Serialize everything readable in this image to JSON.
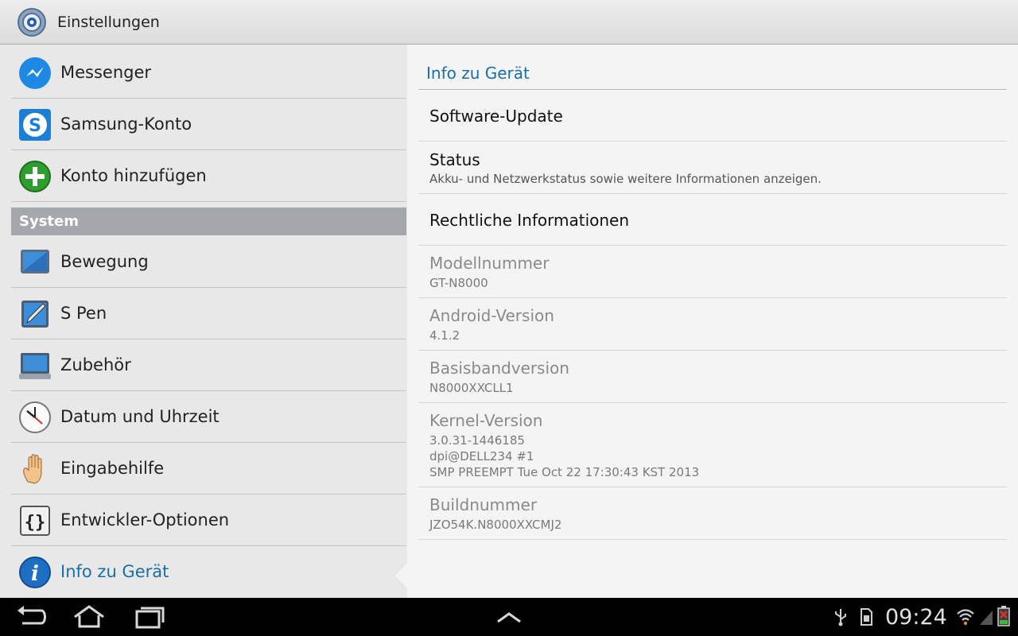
{
  "app": {
    "title": "Einstellungen",
    "icon": "settings-gear-icon"
  },
  "sidebar": {
    "items_top": [
      {
        "label": "Messenger",
        "icon": "messenger-icon"
      },
      {
        "label": "Samsung-Konto",
        "icon": "samsung-account-icon"
      },
      {
        "label": "Konto hinzufügen",
        "icon": "add-account-icon"
      }
    ],
    "section_label": "System",
    "items_system": [
      {
        "label": "Bewegung",
        "icon": "motion-icon"
      },
      {
        "label": "S Pen",
        "icon": "s-pen-icon"
      },
      {
        "label": "Zubehör",
        "icon": "accessory-icon"
      },
      {
        "label": "Datum und Uhrzeit",
        "icon": "clock-icon"
      },
      {
        "label": "Eingabehilfe",
        "icon": "hand-icon"
      },
      {
        "label": "Entwickler-Optionen",
        "icon": "braces-icon"
      },
      {
        "label": "Info zu Gerät",
        "icon": "info-icon",
        "active": true
      }
    ]
  },
  "detail": {
    "header": "Info zu Gerät",
    "software_update": {
      "title": "Software-Update"
    },
    "status": {
      "title": "Status",
      "summary": "Akku- und Netzwerkstatus sowie weitere Informationen anzeigen."
    },
    "legal": {
      "title": "Rechtliche Informationen"
    },
    "model": {
      "title": "Modellnummer",
      "value": "GT-N8000"
    },
    "android": {
      "title": "Android-Version",
      "value": "4.1.2"
    },
    "baseband": {
      "title": "Basisbandversion",
      "value": "N8000XXCLL1"
    },
    "kernel": {
      "title": "Kernel-Version",
      "line1": "3.0.31-1446185",
      "line2": "dpi@DELL234 #1",
      "line3": "SMP PREEMPT Tue Oct 22 17:30:43 KST 2013"
    },
    "build": {
      "title": "Buildnummer",
      "value": "JZO54K.N8000XXCMJ2"
    }
  },
  "navbar": {
    "buttons": [
      "back-icon",
      "home-icon",
      "recent-apps-icon",
      "chevron-up-icon"
    ],
    "status_icons": [
      "usb-icon",
      "sd-card-icon",
      "wifi-icon",
      "signal-icon",
      "battery-icon"
    ],
    "time": "09:24"
  },
  "colors": {
    "accent": "#1a6fa8",
    "section_bg": "#a4a8ac",
    "navbar_bg": "#000000"
  }
}
